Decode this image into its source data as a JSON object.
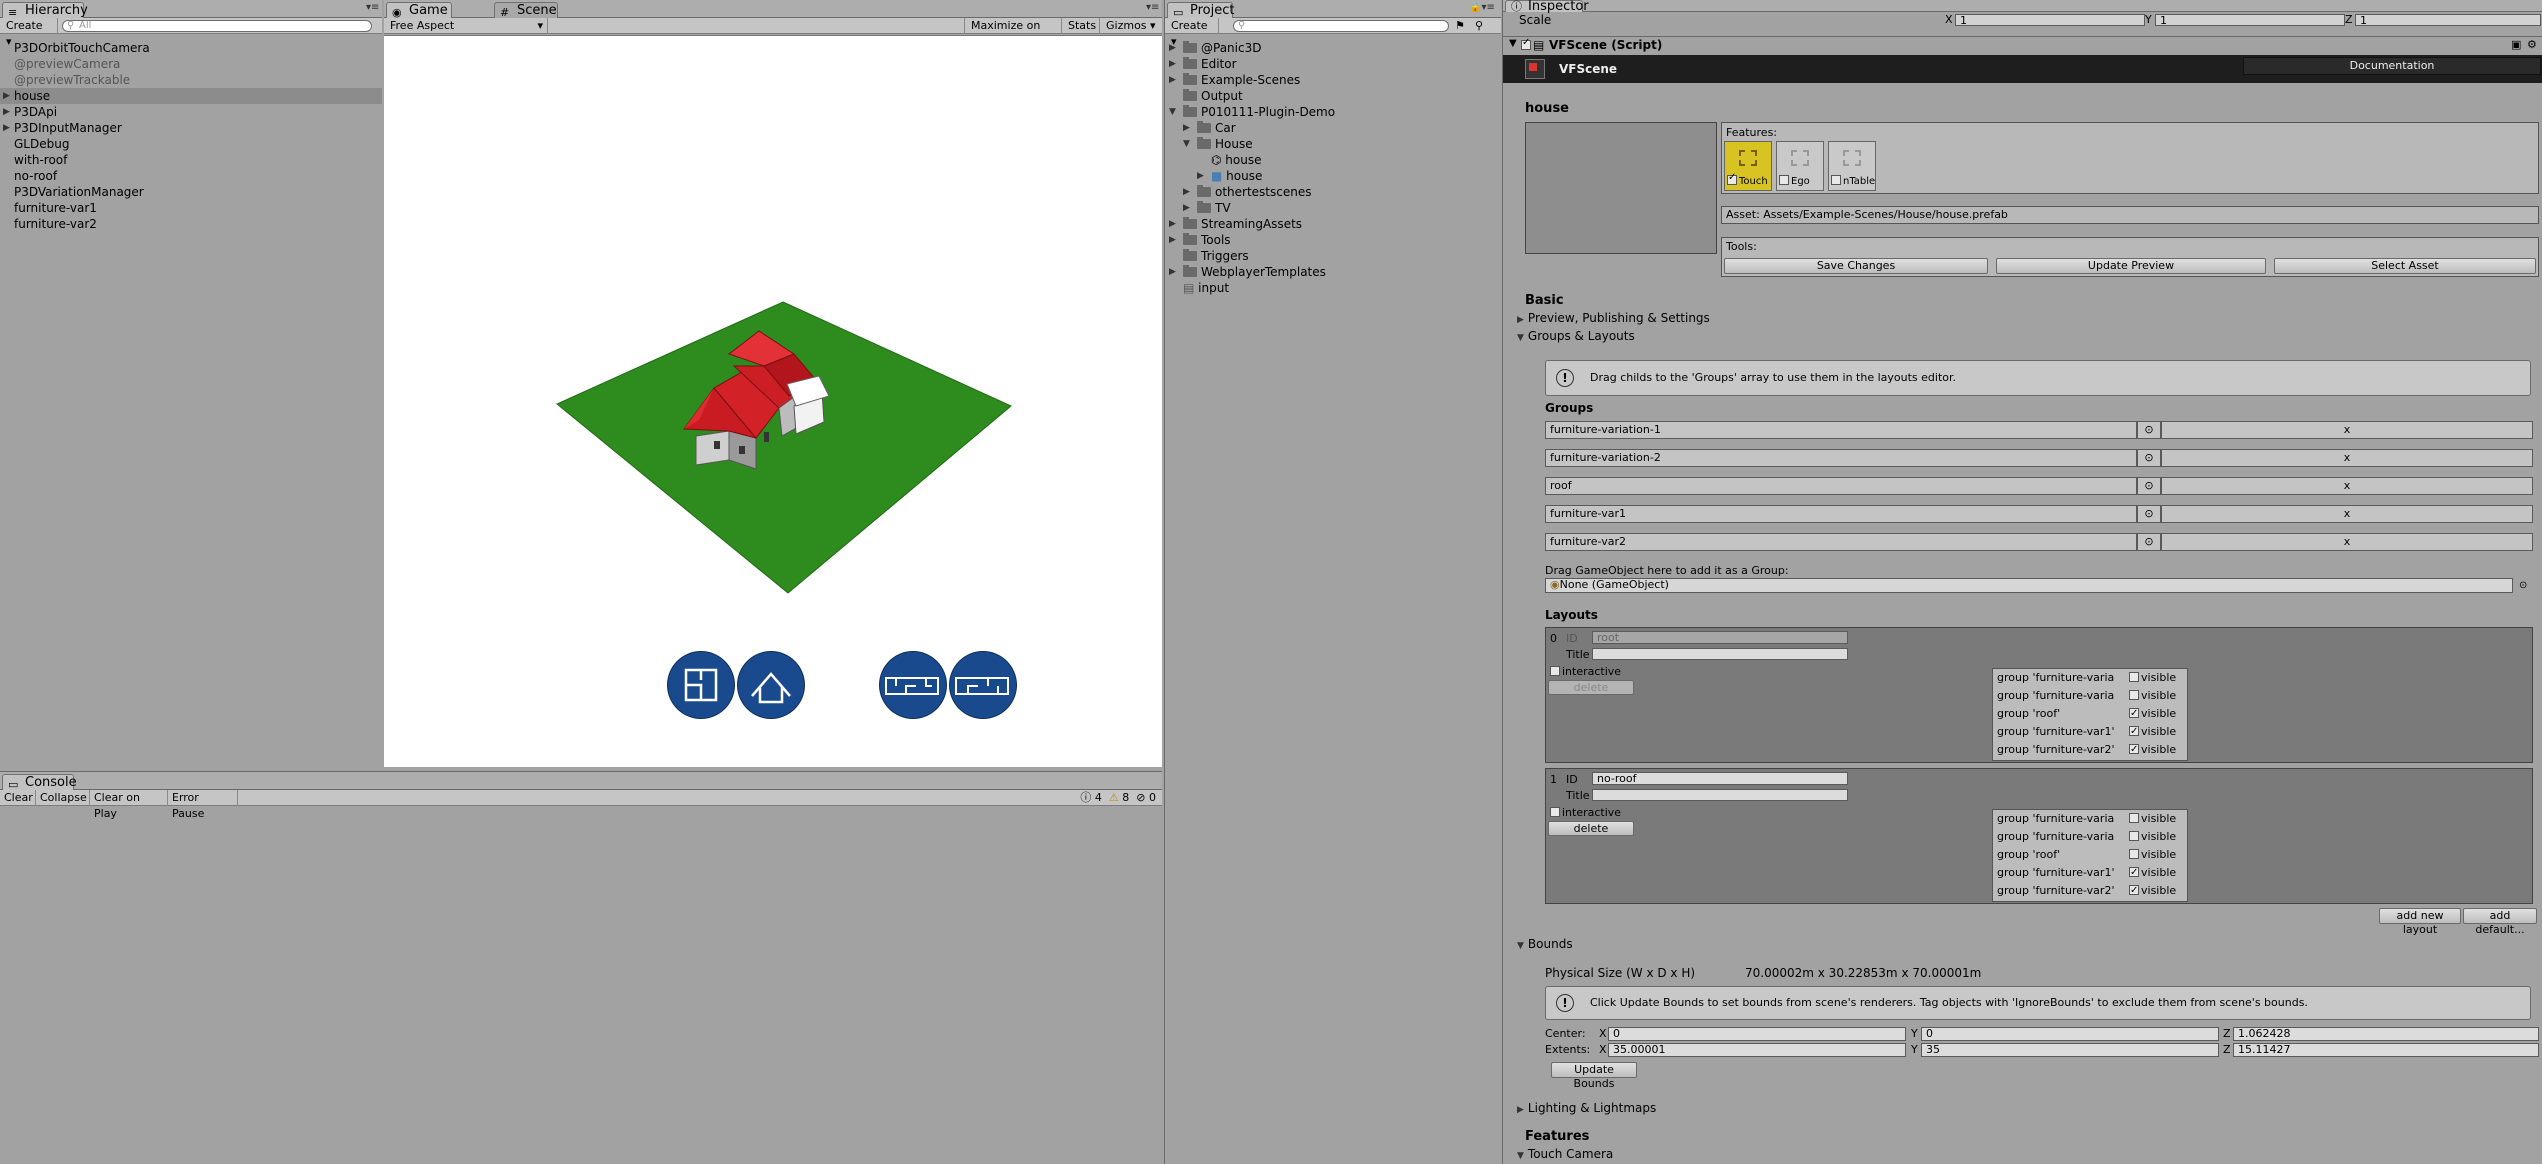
{
  "hierarchy": {
    "tab": "Hierarchy",
    "create_label": "Create",
    "search_placeholder": "All",
    "items": [
      {
        "label": "P3DOrbitTouchCamera",
        "muted": false
      },
      {
        "label": "@previewCamera",
        "muted": true
      },
      {
        "label": "@previewTrackable",
        "muted": true
      },
      {
        "label": "house",
        "muted": false
      },
      {
        "label": "P3DApi",
        "muted": false
      },
      {
        "label": "P3DInputManager",
        "muted": false
      },
      {
        "label": "GLDebug",
        "muted": false
      },
      {
        "label": "with-roof",
        "muted": false
      },
      {
        "label": "no-roof",
        "muted": false
      },
      {
        "label": "P3DVariationManager",
        "muted": false
      },
      {
        "label": "furniture-var1",
        "muted": false
      },
      {
        "label": "furniture-var2",
        "muted": false
      }
    ]
  },
  "game": {
    "tab_game": "Game",
    "tab_scene": "Scene",
    "aspect": "Free Aspect",
    "maximize": "Maximize on Play",
    "stats": "Stats",
    "gizmos": "Gizmos",
    "buttons": [
      {
        "icon": "floorplan-icon"
      },
      {
        "icon": "roof-icon"
      },
      {
        "icon": "furniture-variation-1-icon"
      },
      {
        "icon": "furniture-variation-2-icon"
      }
    ]
  },
  "console": {
    "tab": "Console",
    "buttons": [
      "Clear",
      "Collapse",
      "Clear on Play",
      "Error Pause"
    ],
    "counts": {
      "log": "4",
      "warn": "8",
      "error": "0"
    }
  },
  "project": {
    "tab": "Project",
    "create_label": "Create",
    "items": [
      {
        "label": "@Panic3D",
        "icon": "folder"
      },
      {
        "label": "Editor",
        "icon": "folder"
      },
      {
        "label": "Example-Scenes",
        "icon": "folder"
      },
      {
        "label": "Output",
        "icon": "folder"
      },
      {
        "label": "P010111-Plugin-Demo",
        "icon": "folder"
      },
      {
        "label": "Car",
        "icon": "folder"
      },
      {
        "label": "House",
        "icon": "folder"
      },
      {
        "label": "house",
        "icon": "scene"
      },
      {
        "label": "house",
        "icon": "prefab"
      },
      {
        "label": "othertestscenes",
        "icon": "folder"
      },
      {
        "label": "TV",
        "icon": "folder"
      },
      {
        "label": "StreamingAssets",
        "icon": "folder"
      },
      {
        "label": "Tools",
        "icon": "folder"
      },
      {
        "label": "Triggers",
        "icon": "folder"
      },
      {
        "label": "WebplayerTemplates",
        "icon": "folder"
      },
      {
        "label": "input",
        "icon": "file"
      }
    ]
  },
  "inspector": {
    "tab": "Inspector",
    "scale_label": "Scale",
    "scale": {
      "x": "1",
      "y": "1",
      "z": "1"
    },
    "component": "VFScene (Script)",
    "header_title": "VFScene",
    "documentation": "Documentation",
    "object_name": "house",
    "features_label": "Features:",
    "features": [
      {
        "label": "Touch",
        "checked": true,
        "active": true
      },
      {
        "label": "Ego",
        "checked": false,
        "active": false
      },
      {
        "label": "nTable",
        "checked": false,
        "active": false
      }
    ],
    "asset_label": "Asset: Assets/Example-Scenes/House/house.prefab",
    "tools_label": "Tools:",
    "tools": [
      "Save Changes",
      "Update Preview",
      "Select Asset"
    ],
    "basic": "Basic",
    "preview_publishing": "Preview, Publishing & Settings",
    "groups_layouts": "Groups & Layouts",
    "groups_help": "Drag childs to the 'Groups' array to use them in the layouts editor.",
    "groups_title": "Groups",
    "groups": [
      "furniture-variation-1",
      "furniture-variation-2",
      "roof",
      "furniture-var1",
      "furniture-var2"
    ],
    "drag_label": "Drag GameObject here to add it as a Group:",
    "drag_value": "None (GameObject)",
    "layouts_title": "Layouts",
    "layouts": [
      {
        "index": "0",
        "id": "root",
        "title": "",
        "interactive": false,
        "delete": "delete",
        "groups": [
          {
            "label": "group 'furniture-varia",
            "visible": false
          },
          {
            "label": "group 'furniture-varia",
            "visible": false
          },
          {
            "label": "group 'roof'",
            "visible": true
          },
          {
            "label": "group 'furniture-var1'",
            "visible": true
          },
          {
            "label": "group 'furniture-var2'",
            "visible": true
          }
        ]
      },
      {
        "index": "1",
        "id": "no-roof",
        "title": "",
        "interactive": false,
        "delete": "delete",
        "groups": [
          {
            "label": "group 'furniture-varia",
            "visible": false
          },
          {
            "label": "group 'furniture-varia",
            "visible": false
          },
          {
            "label": "group 'roof'",
            "visible": false
          },
          {
            "label": "group 'furniture-var1'",
            "visible": true
          },
          {
            "label": "group 'furniture-var2'",
            "visible": true
          }
        ]
      }
    ],
    "id_label": "ID",
    "title_label": "Title",
    "interactive_label": "interactive",
    "visible_label": "visible",
    "add_new_layout": "add new layout",
    "add_default": "add default...",
    "bounds": "Bounds",
    "physical_size_label": "Physical Size (W x D x H)",
    "physical_size": "70.00002m x 30.22853m x 70.00001m",
    "bounds_help": "Click Update Bounds to set bounds from scene's renderers. Tag objects with 'IgnoreBounds' to exclude them from scene's bounds.",
    "center_label": "Center:",
    "center": {
      "x": "0",
      "y": "0",
      "z": "1.062428"
    },
    "extents_label": "Extents:",
    "extents": {
      "x": "35.00001",
      "y": "35",
      "z": "15.11427"
    },
    "update_bounds": "Update Bounds",
    "lighting": "Lighting & Lightmaps",
    "features_section": "Features",
    "touch_camera": "Touch Camera"
  }
}
